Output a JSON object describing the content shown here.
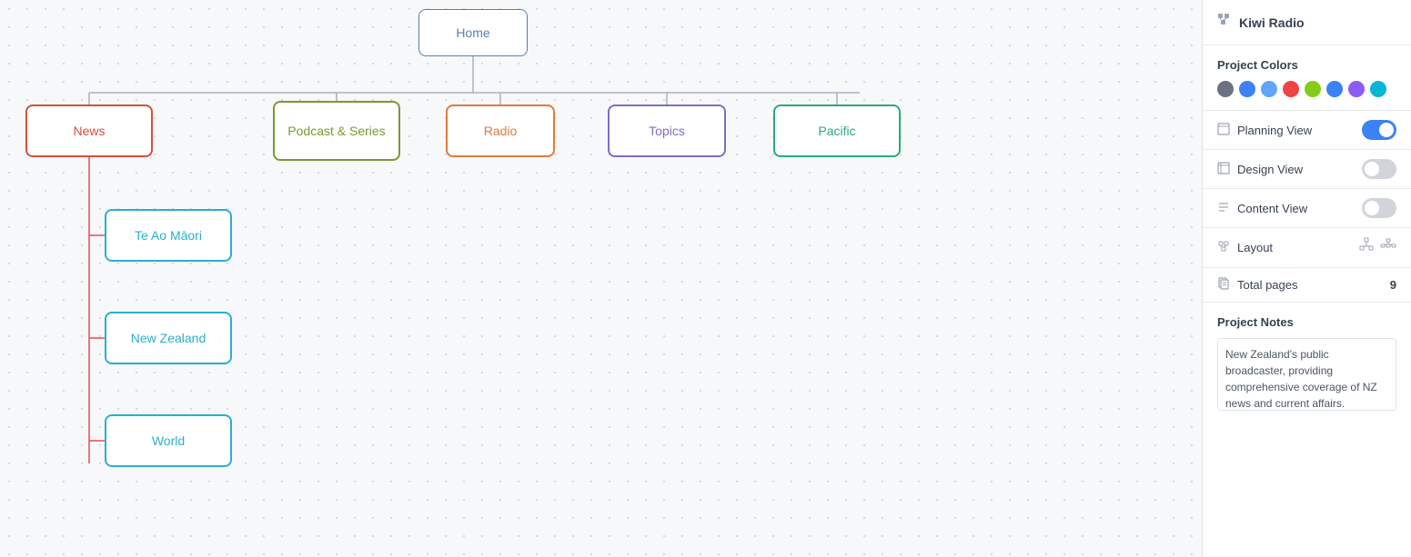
{
  "header": {
    "project_name": "Kiwi Radio",
    "project_icon": "🏗"
  },
  "panel": {
    "project_colors_label": "Project Colors",
    "colors": [
      {
        "hex": "#6b7280",
        "name": "gray"
      },
      {
        "hex": "#3b82f6",
        "name": "blue"
      },
      {
        "hex": "#60a5fa",
        "name": "light-blue"
      },
      {
        "hex": "#ef4444",
        "name": "red"
      },
      {
        "hex": "#84cc16",
        "name": "green"
      },
      {
        "hex": "#3b82f6",
        "name": "blue2"
      },
      {
        "hex": "#8b5cf6",
        "name": "purple"
      },
      {
        "hex": "#06b6d4",
        "name": "cyan"
      }
    ],
    "planning_view_label": "Planning View",
    "planning_view_on": true,
    "design_view_label": "Design View",
    "design_view_on": false,
    "content_view_label": "Content View",
    "content_view_on": false,
    "layout_label": "Layout",
    "total_pages_label": "Total pages",
    "total_pages_value": "9",
    "project_notes_label": "Project Notes",
    "project_notes_text": "New Zealand's public broadcaster, providing comprehensive coverage of NZ news and current affairs."
  },
  "nodes": {
    "home": "Home",
    "news": "News",
    "podcast": "Podcast & Series",
    "radio": "Radio",
    "topics": "Topics",
    "pacific": "Pacific",
    "te_ao": "Te Ao Māori",
    "new_zealand": "New Zealand",
    "world": "World"
  }
}
